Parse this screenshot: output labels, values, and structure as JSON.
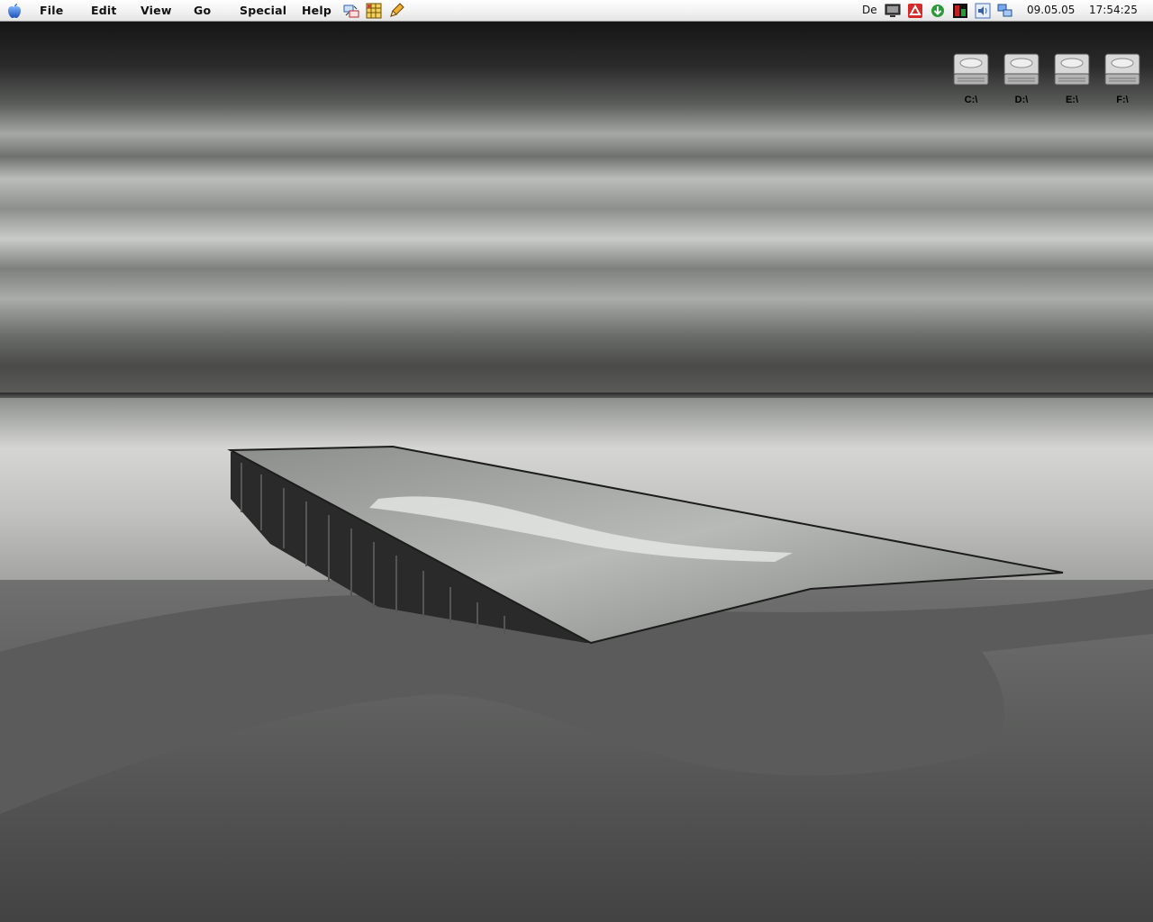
{
  "menubar": {
    "menus": [
      "File",
      "Edit",
      "View",
      "Go",
      "Special",
      "Help"
    ],
    "status": {
      "keyboard_layout": "De",
      "date": "09.05.05",
      "time": "17:54:25"
    }
  },
  "desktop": {
    "wallpaper": "black-and-white long exposure of a pier on a sandy shore",
    "drives": [
      "C:\\",
      "D:\\",
      "E:\\",
      "F:\\"
    ]
  },
  "colors": {
    "menubar_bg": "#f0f0f0",
    "apple_blue": "#2f6fd6",
    "status_red": "#d42a2a",
    "status_green": "#2c9a3a"
  }
}
